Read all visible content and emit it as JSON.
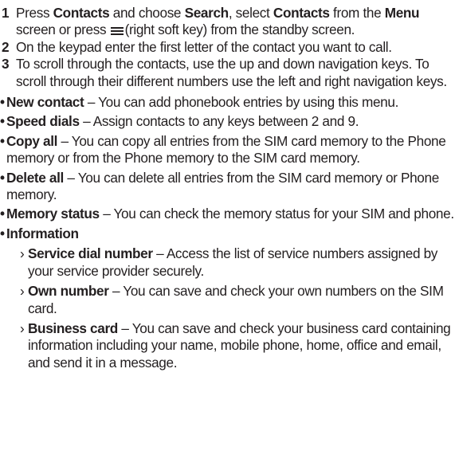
{
  "steps": [
    {
      "number": "1",
      "t1": "Press ",
      "b1": "Contacts",
      "t2": " and choose ",
      "b2": "Search",
      "t3": ", select ",
      "b3": "Contacts",
      "t4": " from the ",
      "b4": "Menu",
      "t5": " screen or press ",
      "icon": "softkey-menu-icon",
      "t6": "(right soft key) from the standby screen."
    },
    {
      "number": "2",
      "text": "On the keypad enter the first letter of the contact you want to call."
    },
    {
      "number": "3",
      "text": "To scroll through the contacts, use the up and down navigation keys. To scroll through their different numbers use the left and right navigation keys."
    }
  ],
  "bullet_marker": "•",
  "sub_marker": "›",
  "bullets": [
    {
      "term": "New contact",
      "desc": " – You can add phonebook entries by using this menu."
    },
    {
      "term": "Speed dials",
      "desc": " – Assign contacts to any keys between 2 and 9."
    },
    {
      "term": "Copy all",
      "desc": " – You can copy all entries from the SIM card memory to the Phone memory or from the Phone memory to the SIM card memory."
    },
    {
      "term": "Delete all",
      "desc": " – You can delete all entries from the SIM card memory or Phone memory."
    },
    {
      "term": "Memory status",
      "desc": " – You can check the memory status for your SIM and phone."
    },
    {
      "term": "Information",
      "desc": ""
    }
  ],
  "sub_items": [
    {
      "term": "Service dial number",
      "desc": " – Access the list of service numbers assigned by your service provider securely."
    },
    {
      "term": "Own number",
      "desc": " – You can save and check your own numbers on the SIM card."
    },
    {
      "term": "Business card",
      "desc": " – You can save and check your business card containing information including your name, mobile phone, home, office and email, and send it in a message."
    }
  ]
}
